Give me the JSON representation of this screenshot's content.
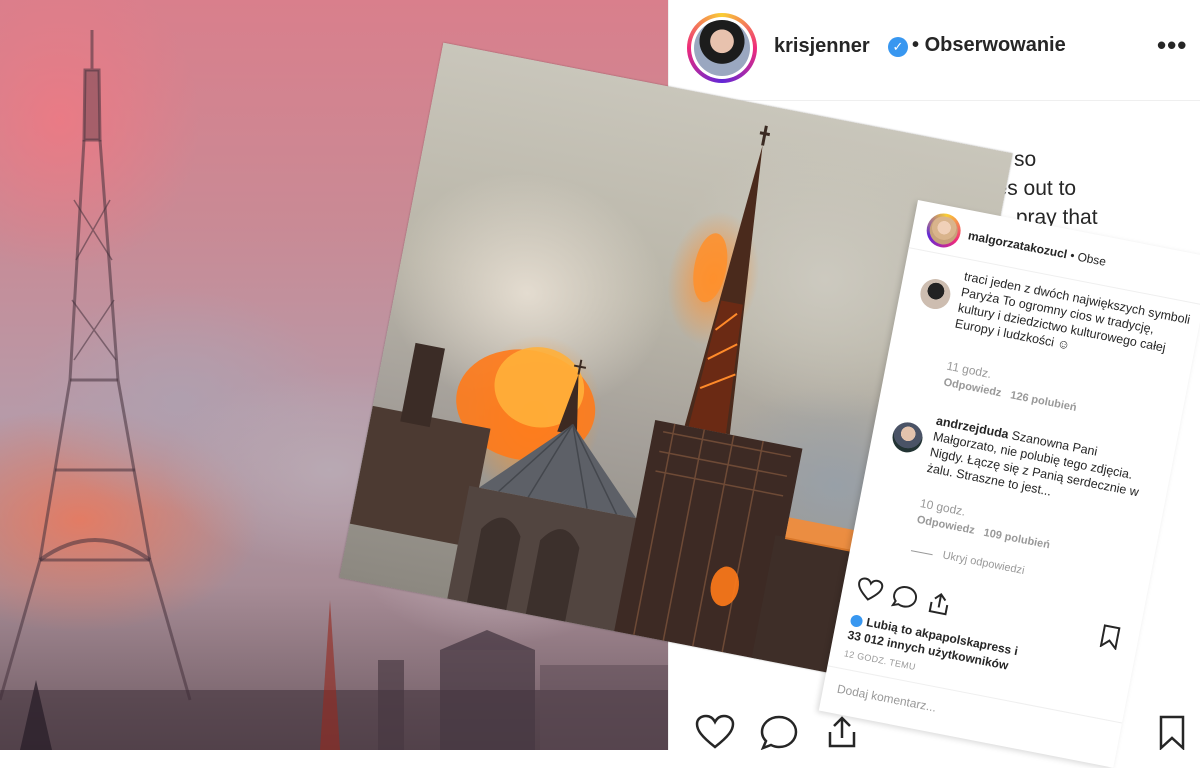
{
  "post": {
    "username": "krisjenner",
    "verified_badge": "✓",
    "separator": "•",
    "follow_status": "Obserwowanie",
    "more_icon": "•••",
    "caption_lines": [
      "This is just so",
      "…st goes out to",
      "… pray that"
    ]
  },
  "comment_card": {
    "username": "malgorzatakozucl",
    "header_suffix": "• Obse",
    "comments": [
      {
        "text": "traci jeden z dwóch największych symboli Paryża To ogromny cios w tradycję, kultury i dziedzictwo kulturowego całej Europy i ludzkości ☺",
        "time": "11 godz.",
        "reply_label": "Odpowiedz",
        "likes": "126 polubień"
      },
      {
        "author": "andrzejduda",
        "text": "Szanowna Pani Małgorzato, nie polubię tego zdjęcia. Nigdy. Łączę się z Panią serdecznie w żalu. Straszne to jest...",
        "time": "10 godz.",
        "reply_label": "Odpowiedz",
        "likes": "109 polubień"
      }
    ],
    "hide_replies": "Ukryj odpowiedzi",
    "liked_by_prefix": "Lubią to",
    "liked_by_user": "akpapolskapress",
    "liked_by_connector": "i",
    "liked_by_others": "33 012 innych użytkowników",
    "post_time": "12 GODZ. TEMU",
    "add_comment_placeholder": "Dodaj komentarz..."
  },
  "icons": {
    "heart": "heart-icon",
    "comment": "comment-icon",
    "share": "share-icon",
    "bookmark": "bookmark-icon",
    "more": "more-options-icon"
  },
  "colors": {
    "verified_blue": "#3897f0",
    "text": "#262626",
    "muted": "#999999",
    "fire": "#ff7a1a"
  }
}
